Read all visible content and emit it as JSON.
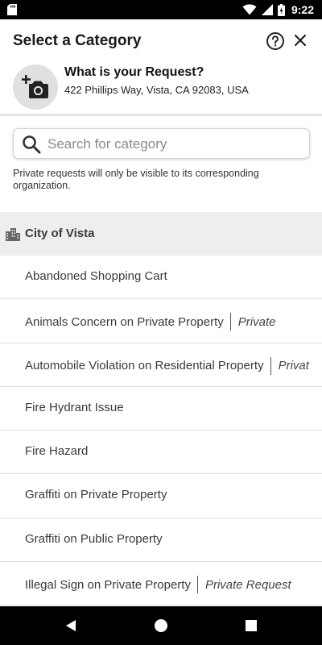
{
  "status_bar": {
    "time": "9:22",
    "icons": [
      "sd-card-icon",
      "wifi-icon",
      "signal-icon",
      "battery-icon"
    ]
  },
  "header": {
    "title": "Select a Category",
    "help_icon": "help-circle-icon",
    "close_icon": "close-icon"
  },
  "request": {
    "photo_icon": "add-photo-icon",
    "title": "What is your Request?",
    "address": "422 Phillips Way, Vista, CA 92083, USA"
  },
  "search": {
    "placeholder": "Search for category",
    "value": ""
  },
  "notice": "Private requests will only be visible to its corresponding organization.",
  "organization": {
    "icon": "building-icon",
    "name": "City of Vista"
  },
  "categories": [
    {
      "label": "Abandoned Shopping Cart",
      "tag": ""
    },
    {
      "label": "Animals Concern on Private Property",
      "tag": "Private"
    },
    {
      "label": "Automobile Violation on Residential Property",
      "tag": "Privat"
    },
    {
      "label": "Fire Hydrant Issue",
      "tag": ""
    },
    {
      "label": "Fire Hazard",
      "tag": ""
    },
    {
      "label": "Graffiti on Private Property",
      "tag": ""
    },
    {
      "label": "Graffiti on Public Property",
      "tag": ""
    },
    {
      "label": "Illegal Sign on Private Property",
      "tag": "Private Request"
    }
  ],
  "nav_bar": {
    "icons": [
      "back-icon",
      "home-icon",
      "recents-icon"
    ]
  },
  "colors": {
    "status_bar": "#000000",
    "org_header_bg": "#eeeeee",
    "photo_circle": "#e0e0e0",
    "text_primary": "#212121",
    "divider": "#dddddd"
  }
}
